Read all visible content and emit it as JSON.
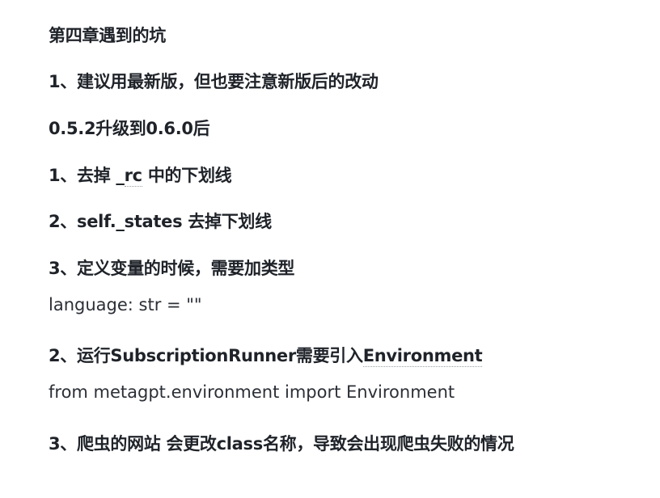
{
  "document": {
    "heading": "第四章遇到的坑",
    "tip1": "1、建议用最新版，但也要注意新版后的改动",
    "version_note": "0.5.2升级到0.6.0后",
    "change1_prefix": "1、去掉 _",
    "change1_code": "rc",
    "change1_suffix": " 中的下划线",
    "change2": "2、self._states 去掉下划线",
    "change3": "3、定义变量的时候，需要加类型",
    "code1": "language: str = \"\"",
    "tip2_prefix": "2、运行SubscriptionRunner需要引入",
    "tip2_link": "Environment",
    "code2": "from metagpt.environment import Environment",
    "tip3": "3、爬虫的网站 会更改class名称，导致会出现爬虫失败的情况"
  }
}
